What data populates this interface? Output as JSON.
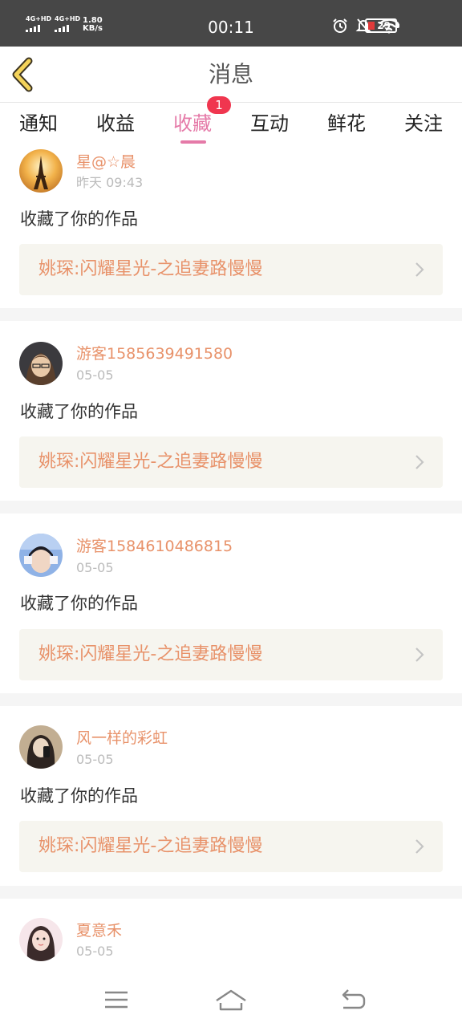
{
  "status_bar": {
    "net1": "4G+HD",
    "net2": "4G+HD",
    "speed_value": "1.80",
    "speed_unit": "KB/s",
    "time": "00:11",
    "battery": "29"
  },
  "header": {
    "title": "消息"
  },
  "tabs": {
    "items": [
      {
        "label": "通知"
      },
      {
        "label": "收益"
      },
      {
        "label": "收藏"
      },
      {
        "label": "互动"
      },
      {
        "label": "鲜花"
      },
      {
        "label": "关注"
      }
    ],
    "active": "收藏",
    "badge": "1"
  },
  "messages": [
    {
      "username": "星@☆晨",
      "date": "昨天 09:43",
      "action": "收藏了你的作品",
      "work": "姚琛:闪耀星光-之追妻路慢慢"
    },
    {
      "username": "游客1585639491580",
      "date": "05-05",
      "action": "收藏了你的作品",
      "work": "姚琛:闪耀星光-之追妻路慢慢"
    },
    {
      "username": "游客1584610486815",
      "date": "05-05",
      "action": "收藏了你的作品",
      "work": "姚琛:闪耀星光-之追妻路慢慢"
    },
    {
      "username": "风一样的彩虹",
      "date": "05-05",
      "action": "收藏了你的作品",
      "work": "姚琛:闪耀星光-之追妻路慢慢"
    },
    {
      "username": "夏意禾",
      "date": "05-05"
    }
  ],
  "colors": {
    "accent": "#e57aa8",
    "username": "#e8926a",
    "badge": "#f0364f",
    "card_bg": "#f6f5ef"
  }
}
